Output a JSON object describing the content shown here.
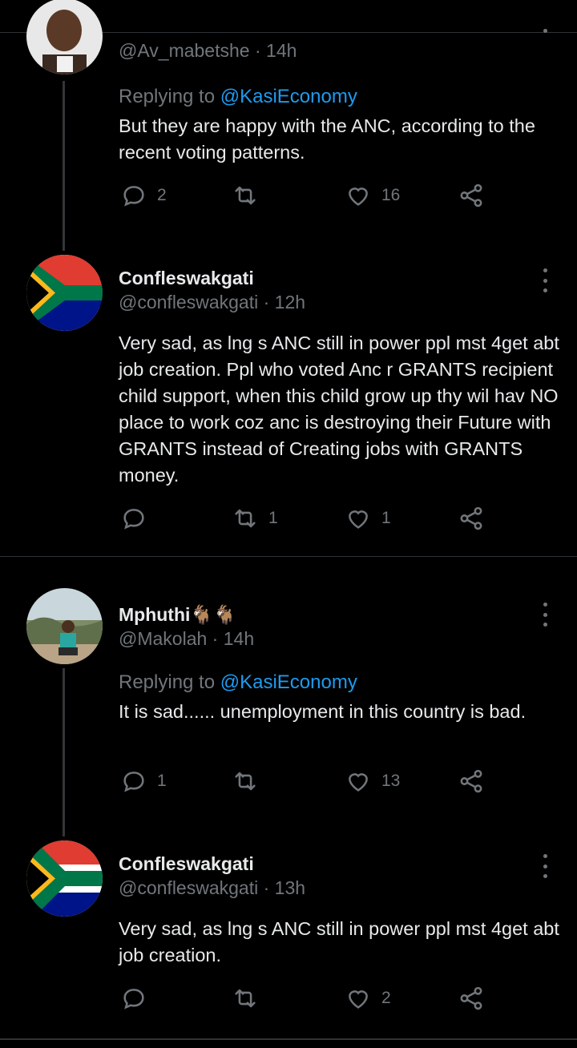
{
  "tweets": [
    {
      "name": "",
      "handle": "@Av_mabetshe",
      "time": "14h",
      "replying_label": "Replying to",
      "replying_to": "@KasiEconomy",
      "text": "But they are happy with the ANC, according to the recent voting patterns.",
      "replies": "2",
      "retweets": "",
      "likes": "16"
    },
    {
      "name": "Confleswakgati",
      "handle": "@confleswakgati",
      "time": "12h",
      "text": "Very sad, as lng s ANC still in power ppl mst 4get abt job creation. Ppl who voted Anc r GRANTS recipient child support, when this child grow up thy wil hav NO place to work coz anc is destroying their Future with GRANTS instead of Creating jobs with GRANTS money.",
      "replies": "",
      "retweets": "1",
      "likes": "1"
    },
    {
      "name": "Mphuthi🐐🐐",
      "handle": "@Makolah",
      "time": "14h",
      "replying_label": "Replying to",
      "replying_to": "@KasiEconomy",
      "text": "It is sad...... unemployment in this country is bad.",
      "replies": "1",
      "retweets": "",
      "likes": "13"
    },
    {
      "name": "Confleswakgati",
      "handle": "@confleswakgati",
      "time": "13h",
      "text": "Very sad, as lng s ANC still in power ppl mst 4get abt job creation.",
      "replies": "",
      "retweets": "",
      "likes": "2"
    }
  ],
  "handle_sep": " · "
}
